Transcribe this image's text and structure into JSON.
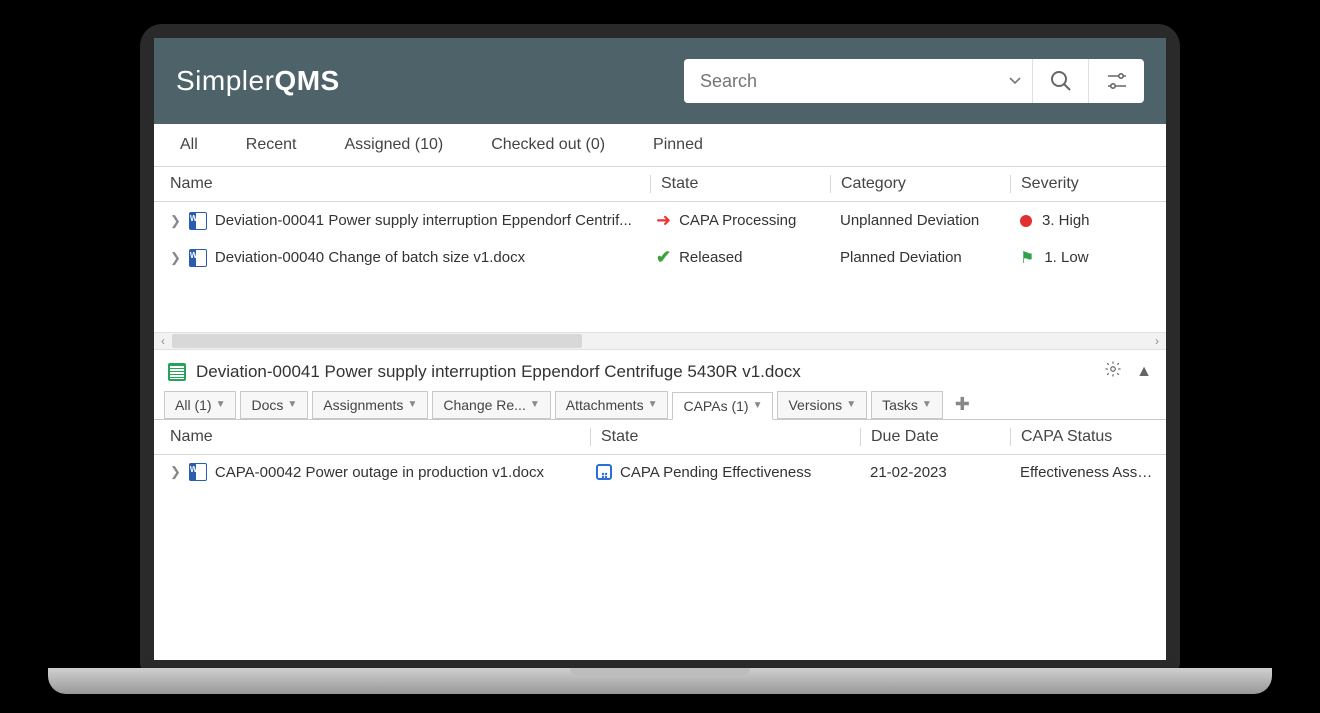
{
  "logo": {
    "part1": "Simpler",
    "part2": "QMS"
  },
  "search": {
    "placeholder": "Search"
  },
  "filterTabs": {
    "all": "All",
    "recent": "Recent",
    "assigned": "Assigned (10)",
    "checkedOut": "Checked out (0)",
    "pinned": "Pinned"
  },
  "mainHeaders": {
    "name": "Name",
    "state": "State",
    "category": "Category",
    "severity": "Severity"
  },
  "rows": [
    {
      "name": "Deviation-00041 Power supply interruption Eppendorf Centrif...",
      "state": "CAPA Processing",
      "stateIcon": "arrow-red",
      "category": "Unplanned Deviation",
      "severity": "3. High",
      "sevIcon": "dot-red"
    },
    {
      "name": "Deviation-00040 Change of batch size v1.docx",
      "state": "Released",
      "stateIcon": "check-green",
      "category": "Planned Deviation",
      "severity": "1. Low",
      "sevIcon": "flag-green"
    }
  ],
  "detail": {
    "title": "Deviation-00041 Power supply interruption Eppendorf Centrifuge 5430R v1.docx",
    "tabs": {
      "all": "All (1)",
      "docs": "Docs",
      "assignments": "Assignments",
      "changeRe": "Change Re...",
      "attachments": "Attachments",
      "capas": "CAPAs (1)",
      "versions": "Versions",
      "tasks": "Tasks"
    },
    "capaHeaders": {
      "name": "Name",
      "state": "State",
      "dueDate": "Due Date",
      "capaStatus": "CAPA Status"
    },
    "capaRows": [
      {
        "name": "CAPA-00042 Power outage in production v1.docx",
        "state": "CAPA Pending Effectiveness",
        "dueDate": "21-02-2023",
        "capaStatus": "Effectiveness Asse..."
      }
    ]
  }
}
